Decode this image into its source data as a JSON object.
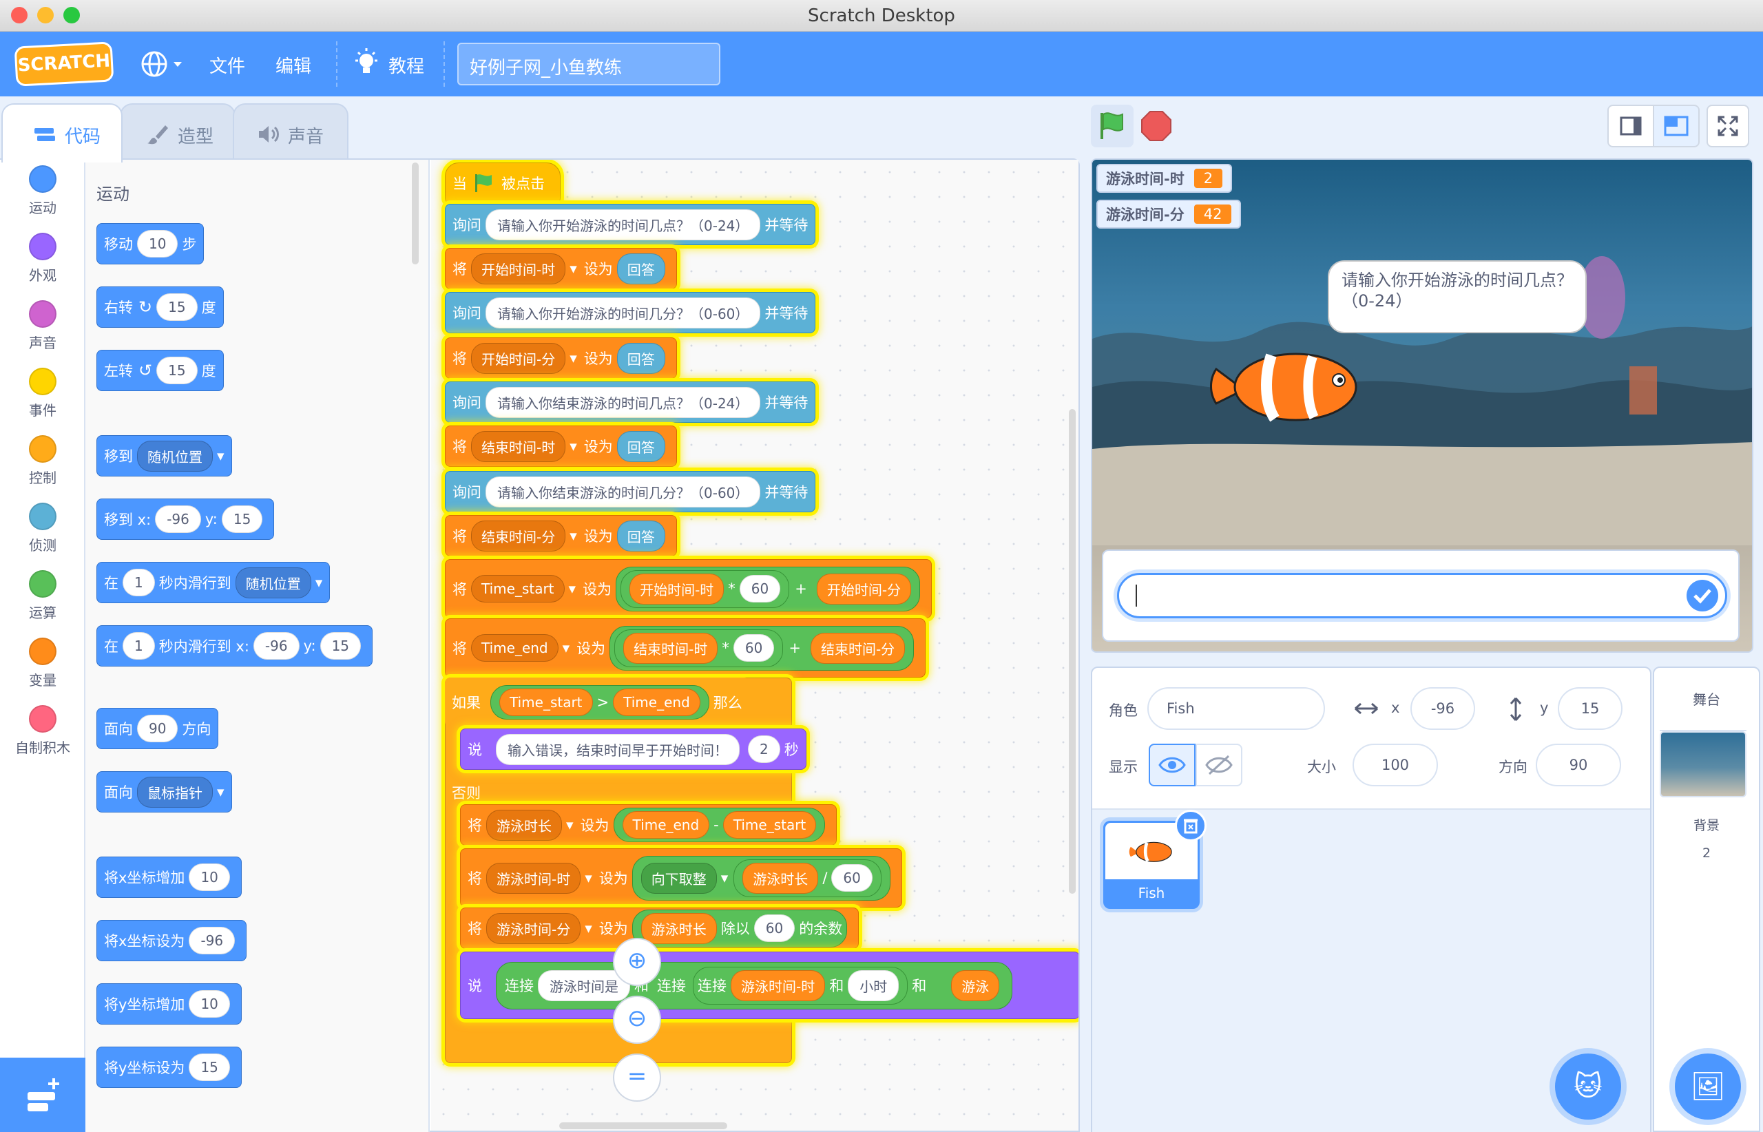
{
  "window": {
    "title": "Scratch Desktop"
  },
  "menu": {
    "logo": "SCRATCH",
    "file": "文件",
    "edit": "编辑",
    "tutorials": "教程",
    "project_title": "好例子网_小鱼教练"
  },
  "tabs": [
    {
      "label": "代码"
    },
    {
      "label": "造型"
    },
    {
      "label": "声音"
    }
  ],
  "categories": [
    {
      "label": "运动",
      "color": "#4c97ff"
    },
    {
      "label": "外观",
      "color": "#9966ff"
    },
    {
      "label": "声音",
      "color": "#cf63cf"
    },
    {
      "label": "事件",
      "color": "#ffd500"
    },
    {
      "label": "控制",
      "color": "#ffab19"
    },
    {
      "label": "侦测",
      "color": "#5cb1d6"
    },
    {
      "label": "运算",
      "color": "#59c059"
    },
    {
      "label": "变量",
      "color": "#ff8c1a"
    },
    {
      "label": "自制积木",
      "color": "#ff6680"
    }
  ],
  "palette": {
    "header": "运动",
    "move": {
      "pre": "移动",
      "val": "10",
      "post": "步"
    },
    "turn_right": {
      "pre": "右转",
      "val": "15",
      "post": "度"
    },
    "turn_left": {
      "pre": "左转",
      "val": "15",
      "post": "度"
    },
    "goto": {
      "pre": "移到",
      "dd": "随机位置"
    },
    "goto_xy": {
      "pre": "移到 x:",
      "x": "-96",
      "mid": "y:",
      "y": "15"
    },
    "glide": {
      "pre": "在",
      "val": "1",
      "mid": "秒内滑行到",
      "dd": "随机位置"
    },
    "glide_xy": {
      "pre": "在",
      "val": "1",
      "mid": "秒内滑行到 x:",
      "x": "-96",
      "mid2": "y:",
      "y": "15"
    },
    "point_dir": {
      "pre": "面向",
      "val": "90",
      "post": "方向"
    },
    "point_towards": {
      "pre": "面向",
      "dd": "鼠标指针"
    },
    "change_x": {
      "pre": "将x坐标增加",
      "val": "10"
    },
    "set_x": {
      "pre": "将x坐标设为",
      "val": "-96"
    },
    "change_y": {
      "pre": "将y坐标增加",
      "val": "10"
    },
    "set_y": {
      "pre": "将y坐标设为",
      "val": "15"
    }
  },
  "script": {
    "hat": {
      "when": "当",
      "clicked": "被点击"
    },
    "ask1": {
      "ask": "询问",
      "q": "请输入你开始游泳的时间几点？（0-24）",
      "wait": "并等待"
    },
    "set1": {
      "set": "将",
      "var": "开始时间-时",
      "to": "设为",
      "ans": "回答"
    },
    "ask2": {
      "ask": "询问",
      "q": "请输入你开始游泳的时间几分？（0-60）",
      "wait": "并等待"
    },
    "set2": {
      "set": "将",
      "var": "开始时间-分",
      "to": "设为",
      "ans": "回答"
    },
    "ask3": {
      "ask": "询问",
      "q": "请输入你结束游泳的时间几点？（0-24）",
      "wait": "并等待"
    },
    "set3": {
      "set": "将",
      "var": "结束时间-时",
      "to": "设为",
      "ans": "回答"
    },
    "ask4": {
      "ask": "询问",
      "q": "请输入你结束游泳的时间几分？（0-60）",
      "wait": "并等待"
    },
    "set4": {
      "set": "将",
      "var": "结束时间-分",
      "to": "设为",
      "ans": "回答"
    },
    "set5": {
      "set": "将",
      "var": "Time_start",
      "to": "设为",
      "a": "开始时间-时",
      "op1": "*",
      "n": "60",
      "op2": "+",
      "b": "开始时间-分"
    },
    "set6": {
      "set": "将",
      "var": "Time_end",
      "to": "设为",
      "a": "结束时间-时",
      "op1": "*",
      "n": "60",
      "op2": "+",
      "b": "结束时间-分"
    },
    "if": {
      "if": "如果",
      "a": "Time_start",
      "op": ">",
      "b": "Time_end",
      "then": "那么"
    },
    "say1": {
      "say": "说",
      "msg": "输入错误，结束时间早于开始时间！",
      "n": "2",
      "sec": "秒"
    },
    "else": "否则",
    "set7": {
      "set": "将",
      "var": "游泳时长",
      "to": "设为",
      "a": "Time_end",
      "op": "-",
      "b": "Time_start"
    },
    "set8": {
      "set": "将",
      "var": "游泳时间-时",
      "to": "设为",
      "fn": "向下取整",
      "a": "游泳时长",
      "op": "/",
      "n": "60"
    },
    "set9": {
      "set": "将",
      "var": "游泳时间-分",
      "to": "设为",
      "a": "游泳时长",
      "mod": "除以",
      "n": "60",
      "rem": "的余数"
    },
    "say2": {
      "say": "说",
      "join": "连接",
      "s1": "游泳时间是",
      "and": "和",
      "v": "游泳时间-时",
      "unit": "小时",
      "cut1": "游",
      "cut2": "游泳"
    }
  },
  "stage": {
    "monitors": [
      {
        "label": "游泳时间-时",
        "value": "2"
      },
      {
        "label": "游泳时间-分",
        "value": "42"
      }
    ],
    "bubble": "请输入你开始游泳的时间几点？（0-24）"
  },
  "sprite_info": {
    "sprite_label": "角色",
    "sprite_name": "Fish",
    "x_label": "x",
    "x": "-96",
    "y_label": "y",
    "y": "15",
    "show_label": "显示",
    "size_label": "大小",
    "size": "100",
    "dir_label": "方向",
    "direction": "90"
  },
  "sprites": [
    {
      "name": "Fish"
    }
  ],
  "stage_panel": {
    "title": "舞台",
    "backdrop_label": "背景",
    "backdrop_count": "2"
  }
}
